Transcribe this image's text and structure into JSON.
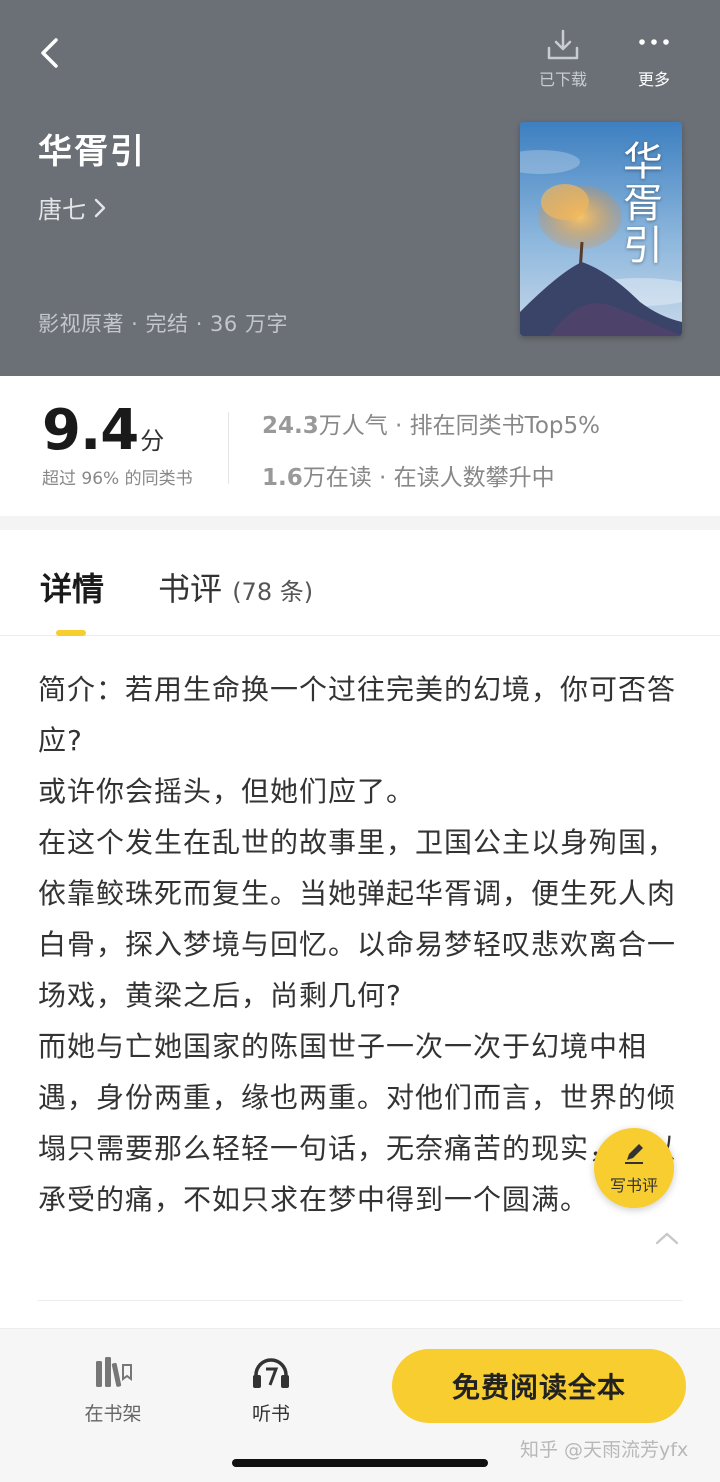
{
  "header": {
    "download_label": "已下载",
    "more_label": "更多",
    "title": "华胥引",
    "author": "唐七",
    "meta": "影视原著 · 完结 · 36 万字",
    "cover_title": "华胥引"
  },
  "rating": {
    "score": "9.4",
    "unit": "分",
    "subtitle": "超过 96% 的同类书",
    "popularity_value": "24.3",
    "popularity_text": "万人气 · 排在同类书Top5%",
    "reading_value": "1.6",
    "reading_text": "万在读 · 在读人数攀升中"
  },
  "tabs": {
    "detail": "详情",
    "reviews": "书评",
    "reviews_count": "(78 条)"
  },
  "intro": {
    "p1": "简介：若用生命换一个过往完美的幻境，你可否答应?",
    "p2": "或许你会摇头，但她们应了。",
    "p3": "在这个发生在乱世的故事里，卫国公主以身殉国，依靠鲛珠死而复生。当她弹起华胥调，便生死人肉白骨，探入梦境与回忆。以命易梦轻叹悲欢离合一场戏，黄梁之后，尚剩几何?",
    "p4": "而她与亡她国家的陈国世子一次一次于幻境中相遇，身份两重，缘也两重。对他们而言，世界的倾塌只需要那么轻轻一句话，无奈痛苦的现实，难以承受的痛，不如只求在梦中得到一个圆满。"
  },
  "fab": {
    "label": "写书评"
  },
  "bottom": {
    "shelf_label": "在书架",
    "listen_label": "听书",
    "read_button": "免费阅读全本",
    "watermark": "知乎 @天雨流芳yfx"
  },
  "colors": {
    "header_bg": "#6b7076",
    "accent_yellow": "#f7cd2f"
  }
}
